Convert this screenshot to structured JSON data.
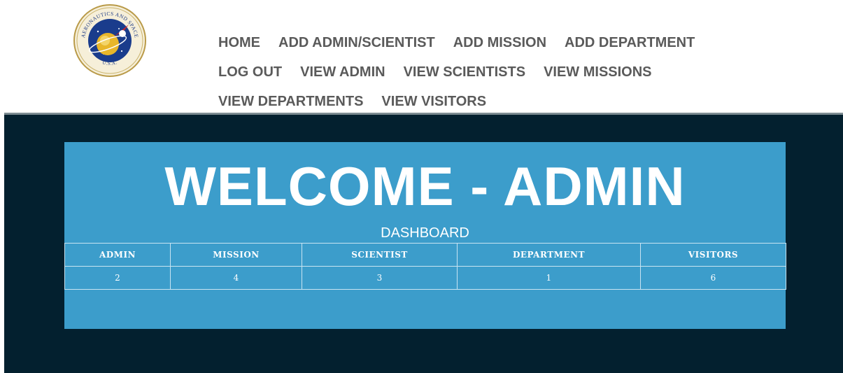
{
  "header": {
    "logo_icon": "nasa-seal-icon",
    "logo_text_top": "AERONAUTICS AND SPACE",
    "logo_text_left": "NATIONAL",
    "logo_text_right": "ADMINISTRATION",
    "logo_text_bottom": "U.S.A.",
    "nav_rows": [
      [
        {
          "name": "nav-home",
          "label": "HOME"
        },
        {
          "name": "nav-add-admin-scientist",
          "label": "ADD ADMIN/SCIENTIST"
        },
        {
          "name": "nav-add-mission",
          "label": "ADD MISSION"
        },
        {
          "name": "nav-add-department",
          "label": "ADD DEPARTMENT"
        }
      ],
      [
        {
          "name": "nav-log-out",
          "label": "LOG OUT"
        },
        {
          "name": "nav-view-admin",
          "label": "VIEW ADMIN"
        },
        {
          "name": "nav-view-scientists",
          "label": "VIEW SCIENTISTS"
        },
        {
          "name": "nav-view-missions",
          "label": "VIEW MISSIONS"
        }
      ],
      [
        {
          "name": "nav-view-departments",
          "label": "VIEW DEPARTMENTS"
        },
        {
          "name": "nav-view-visitors",
          "label": "VIEW VISITORS"
        }
      ]
    ]
  },
  "main": {
    "welcome_title": "WELCOME - ADMIN",
    "dashboard_label": "DASHBOARD",
    "table": {
      "columns": [
        "ADMIN",
        "MISSION",
        "SCIENTIST",
        "DEPARTMENT",
        "VISITORS"
      ],
      "values": [
        "2",
        "4",
        "3",
        "1",
        "6"
      ]
    }
  },
  "colors": {
    "page_background": "#ffffff",
    "dark_background": "#03202f",
    "panel_background": "#3c9dcb",
    "nav_text": "#5a5a5a",
    "divider": "#7d8c92"
  }
}
